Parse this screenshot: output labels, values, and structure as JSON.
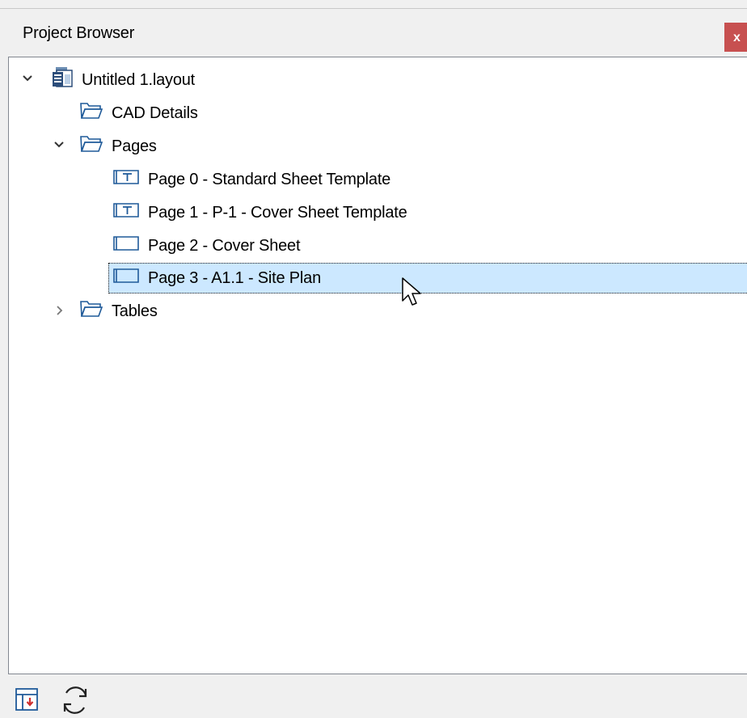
{
  "panel": {
    "title": "Project Browser",
    "close_label": "x"
  },
  "tree": {
    "root": {
      "label": "Untitled 1.layout",
      "icon": "layout-file-icon",
      "expanded": true
    },
    "cad_details": {
      "label": "CAD Details",
      "icon": "folder-icon"
    },
    "pages": {
      "label": "Pages",
      "icon": "folder-icon",
      "expanded": true
    },
    "page0": {
      "label": "Page 0 - Standard Sheet Template",
      "icon": "template-page-icon"
    },
    "page1": {
      "label": "Page 1 - P-1 - Cover Sheet Template",
      "icon": "template-page-icon"
    },
    "page2": {
      "label": "Page 2 - Cover Sheet",
      "icon": "page-icon"
    },
    "page3": {
      "label": "Page 3 - A1.1 - Site Plan",
      "icon": "page-icon",
      "selected": true
    },
    "tables": {
      "label": "Tables",
      "icon": "folder-icon",
      "expanded": false
    }
  },
  "toolbar": {
    "buttons": [
      "send-to-layout-icon",
      "refresh-icon"
    ]
  },
  "colors": {
    "selection": "#cce8ff",
    "close": "#c75050",
    "folder": "#1f5a99"
  }
}
